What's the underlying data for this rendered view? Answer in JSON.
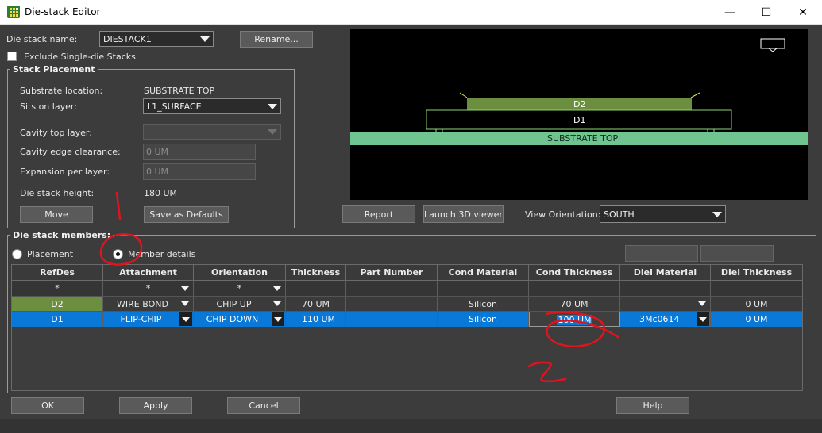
{
  "window": {
    "title": "Die-stack Editor",
    "icon": "grid-app-icon",
    "minimize": "—",
    "maximize": "☐",
    "close": "✕"
  },
  "top": {
    "die_stack_name_label": "Die stack name:",
    "die_stack_name_value": "DIESTACK1",
    "rename_button": "Rename...",
    "exclude_label": "Exclude Single-die Stacks"
  },
  "stack_placement": {
    "title": "Stack Placement",
    "substrate_location_label": "Substrate location:",
    "substrate_location_value": "SUBSTRATE TOP",
    "sits_on_layer_label": "Sits on layer:",
    "sits_on_layer_value": "L1_SURFACE",
    "cavity_top_layer_label": "Cavity top layer:",
    "cavity_edge_label": "Cavity edge clearance:",
    "cavity_edge_value": "0 UM",
    "expansion_label": "Expansion per layer:",
    "expansion_value": "0 UM",
    "height_label": "Die stack height:",
    "height_value": "180 UM",
    "move_button": "Move",
    "save_defaults_button": "Save as Defaults"
  },
  "preview": {
    "d2_label": "D2",
    "d1_label": "D1",
    "substrate_label": "SUBSTRATE TOP",
    "report_button": "Report",
    "launch3d_button": "Launch 3D viewer",
    "orientation_label": "View Orientation:",
    "orientation_value": "SOUTH",
    "colors": {
      "d2": "#6b8e3f",
      "substrate": "#6fc48f",
      "d1_outline": "#8fd36f"
    }
  },
  "members": {
    "title": "Die stack members:",
    "placement_radio": "Placement",
    "member_details_radio": "Member details",
    "columns": [
      "RefDes",
      "Attachment",
      "Orientation",
      "Thickness",
      "Part Number",
      "Cond Material",
      "Cond Thickness",
      "Diel Material",
      "Diel Thickness"
    ],
    "filter": [
      "*",
      "*",
      "*"
    ],
    "rows": [
      {
        "refdes": "D2",
        "attachment": "WIRE BOND",
        "orientation": "CHIP UP",
        "thickness": "70 UM",
        "part_number": "",
        "cond_material": "Silicon",
        "cond_thickness": "70 UM",
        "diel_material": "",
        "diel_thickness": "0 UM"
      },
      {
        "refdes": "D1",
        "attachment": "FLIP-CHIP",
        "orientation": "CHIP DOWN",
        "thickness": "110 UM",
        "part_number": "",
        "cond_material": "Silicon",
        "cond_thickness": "100 UM",
        "diel_material": "3Mc0614",
        "diel_thickness": "0 UM"
      }
    ]
  },
  "buttons": {
    "ok": "OK",
    "apply": "Apply",
    "cancel": "Cancel",
    "help": "Help"
  },
  "annotations": {
    "mark1": "1",
    "mark2": "2",
    "color": "#e0141e"
  }
}
